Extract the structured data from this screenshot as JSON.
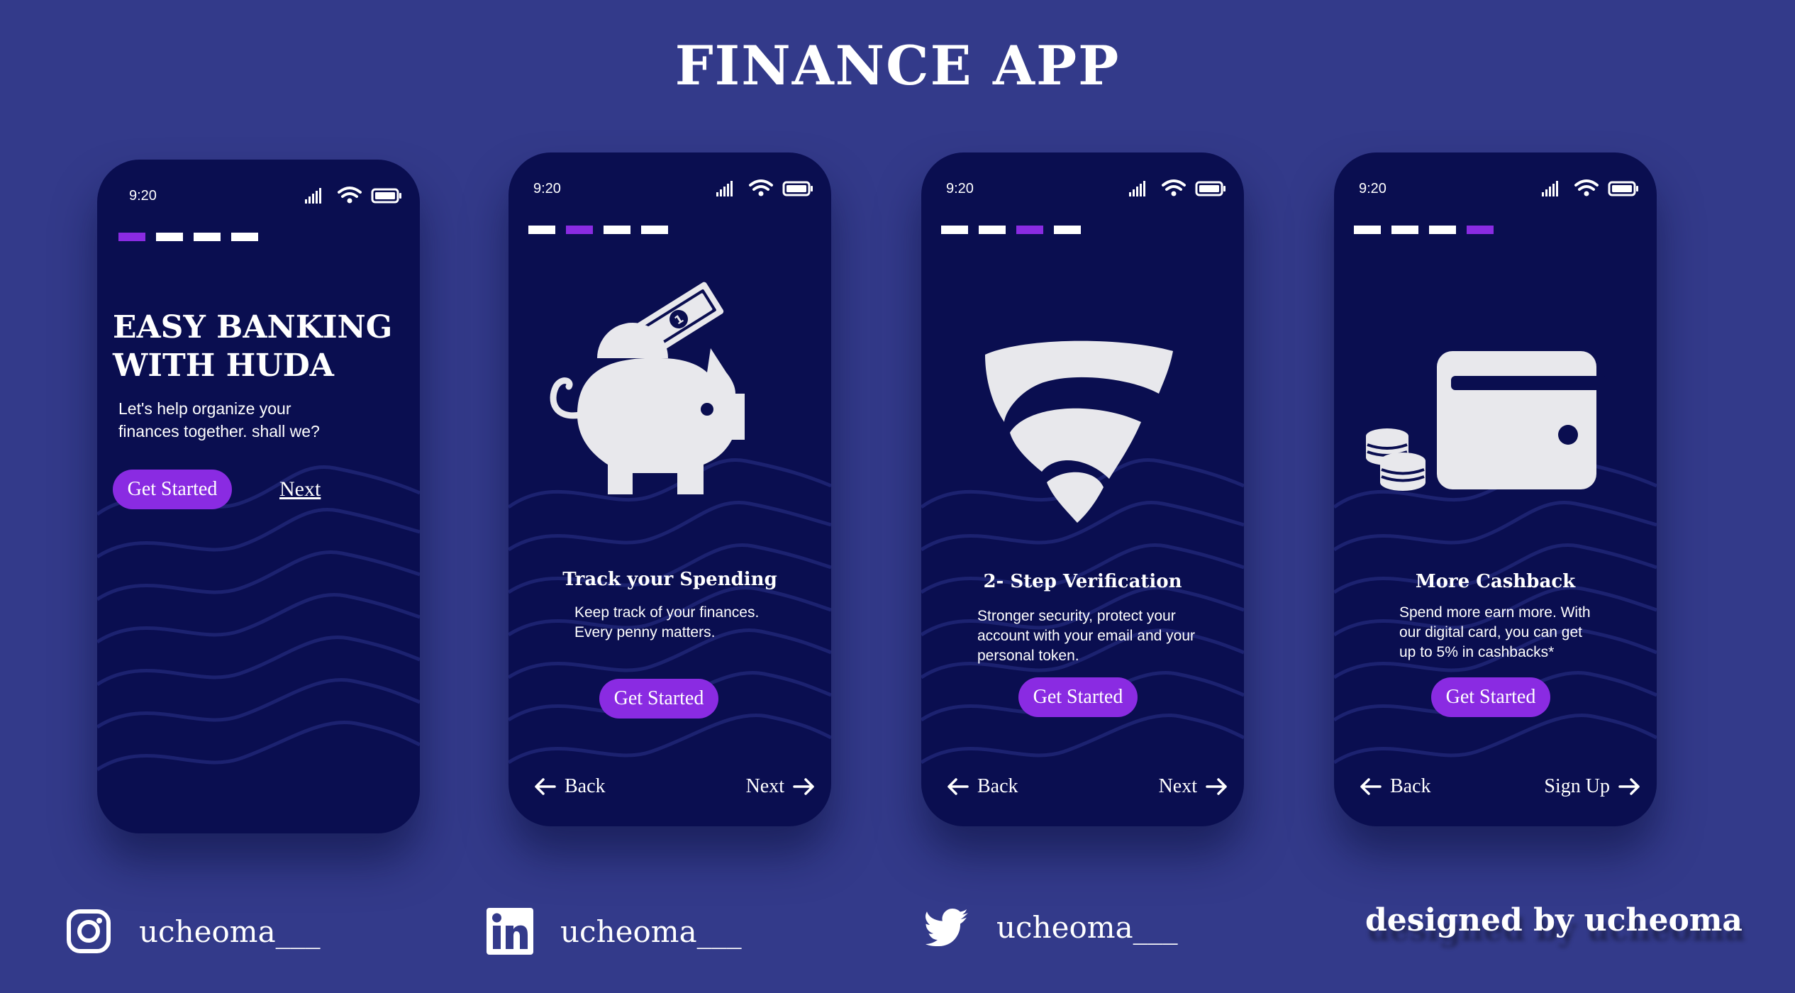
{
  "page_title": "FINANCE APP",
  "colors": {
    "background": "#333a8a",
    "phone": "#0a0e50",
    "accent": "#8a2be2",
    "illustration": "#e8e8ec"
  },
  "screens": [
    {
      "time": "9:20",
      "active_step": 1,
      "illustration": "none",
      "title_line1": "EASY BANKING",
      "title_line2": "WITH HUDA",
      "body_line1": "Let's help organize your",
      "body_line2": "finances together. shall we?",
      "cta": "Get Started",
      "next": "Next"
    },
    {
      "time": "9:20",
      "active_step": 2,
      "illustration": "piggy-bank-icon",
      "title": "Track your Spending",
      "body_line1": "Keep track of your finances.",
      "body_line2": "Every penny matters.",
      "cta": "Get Started",
      "back": "Back",
      "forward": "Next"
    },
    {
      "time": "9:20",
      "active_step": 3,
      "illustration": "shield-icon",
      "title": "2- Step Verification",
      "body_line1": "Stronger security, protect your",
      "body_line2": "account with your email and your",
      "body_line3": "personal token.",
      "cta": "Get Started",
      "back": "Back",
      "forward": "Next"
    },
    {
      "time": "9:20",
      "active_step": 4,
      "illustration": "wallet-icon",
      "title": "More Cashback",
      "body_line1": "Spend more earn more. With",
      "body_line2": "our digital card, you can get",
      "body_line3": "up to 5% in cashbacks*",
      "cta": "Get Started",
      "back": "Back",
      "forward": "Sign Up"
    }
  ],
  "socials": [
    {
      "icon": "instagram-icon",
      "handle": "ucheoma___"
    },
    {
      "icon": "linkedin-icon",
      "handle": "ucheoma___"
    },
    {
      "icon": "twitter-icon",
      "handle": "ucheoma___"
    }
  ],
  "credit": "designed by ucheoma"
}
